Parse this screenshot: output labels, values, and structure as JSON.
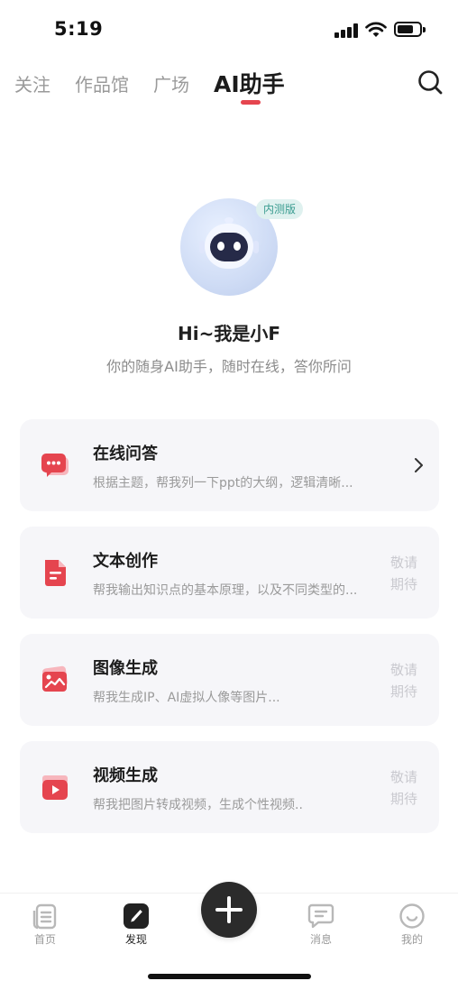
{
  "status_bar": {
    "time": "5:19"
  },
  "top_tabs": [
    {
      "label": "关注"
    },
    {
      "label": "作品馆"
    },
    {
      "label": "广场"
    },
    {
      "label": "AI助手"
    }
  ],
  "hero": {
    "badge": "内测版",
    "title": "Hi~我是小F",
    "subtitle": "你的随身AI助手，随时在线，答你所问"
  },
  "cards": [
    {
      "title": "在线问答",
      "desc": "根据主题，帮我列一下ppt的大纲，逻辑清晰...",
      "icon": "chat-bubble-icon"
    },
    {
      "title": "文本创作",
      "desc": "帮我输出知识点的基本原理，以及不同类型的...",
      "status": "敬请期待",
      "status_line1": "敬请",
      "status_line2": "期待",
      "icon": "document-icon"
    },
    {
      "title": "图像生成",
      "desc": "帮我生成IP、AI虚拟人像等图片...",
      "status": "敬请期待",
      "status_line1": "敬请",
      "status_line2": "期待",
      "icon": "image-icon"
    },
    {
      "title": "视频生成",
      "desc": "帮我把图片转成视频，生成个性视频..",
      "status": "敬请期待",
      "status_line1": "敬请",
      "status_line2": "期待",
      "icon": "video-icon"
    }
  ],
  "bottom_nav": [
    {
      "label": "首页",
      "icon": "home-icon"
    },
    {
      "label": "发现",
      "icon": "discover-icon"
    },
    {
      "label": "消息",
      "icon": "message-icon"
    },
    {
      "label": "我的",
      "icon": "profile-icon"
    }
  ],
  "colors": {
    "accent": "#e5454f",
    "card_bg": "#f6f6f9",
    "badge_bg": "#dff1ef",
    "badge_text": "#3a9c90"
  }
}
